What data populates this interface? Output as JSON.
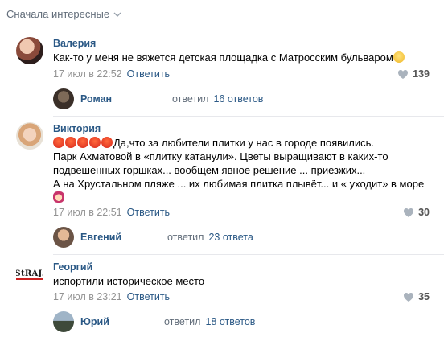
{
  "sort": {
    "label": "Сначала интересные"
  },
  "comments": [
    {
      "author": "Валерия",
      "text": "Как-то у меня не вяжется детская площадка с Матросским бульваром",
      "date": "17 июл в 22:52",
      "reply_label": "Ответить",
      "likes": "139",
      "thread": {
        "user": "Роман",
        "replied": "ответил",
        "count": "16 ответов"
      }
    },
    {
      "author": "Виктория",
      "text_line1": "Да,что за любители плитки у нас в городе появились.",
      "text_line2": "Парк Ахматовой в «плитку катанули». Цветы выращивают в каких-то",
      "text_line3": "подвешенных горшках... вообщем явное решение ... приезжих...",
      "text_line4": "А на Хрустальном пляже ... их любимая плитка плывёт... и « уходит» в море",
      "date": "17 июл в 22:51",
      "reply_label": "Ответить",
      "likes": "30",
      "thread": {
        "user": "Евгений",
        "replied": "ответил",
        "count": "23 ответа"
      }
    },
    {
      "author": "Георгий",
      "avatar_text": "StRAJ.",
      "text": "испортили историческое место",
      "date": "17 июл в 23:21",
      "reply_label": "Ответить",
      "likes": "35",
      "thread": {
        "user": "Юрий",
        "replied": "ответил",
        "count": "18 ответов"
      }
    }
  ],
  "colors": {
    "link": "#2a5885",
    "meta": "#939393",
    "divider": "#e7e8ec"
  }
}
